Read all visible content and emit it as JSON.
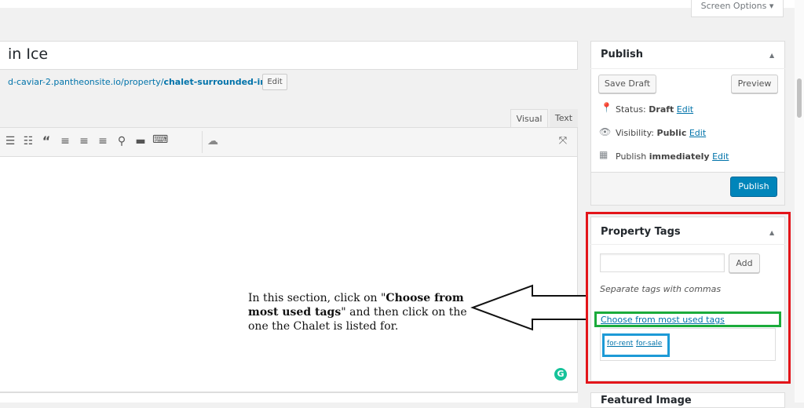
{
  "header": {
    "screen_options_label": "Screen Options ▾"
  },
  "post": {
    "title": "in Ice",
    "permalink_prefix": "d-caviar-2.pantheonsite.io/property/",
    "permalink_slug": "chalet-surrounded-in-ice",
    "permalink_suffix": "/",
    "permalink_edit_label": "Edit"
  },
  "editor": {
    "tabs": {
      "visual": "Visual",
      "text": "Text"
    },
    "toolbar_icons": [
      "bullet-list-icon",
      "numbered-list-icon",
      "blockquote-icon",
      "align-left-icon",
      "align-center-icon",
      "align-right-icon",
      "link-icon",
      "read-more-icon",
      "toolbar-toggle-icon",
      "cloud-icon",
      "fullscreen-icon"
    ],
    "grammarly_label": "G"
  },
  "annotation": {
    "text_1": "In this section, click on \"",
    "bold": "Choose from most used tags",
    "text_2": "\" and then click on the one the Chalet is listed for."
  },
  "publish": {
    "title": "Publish",
    "save_draft": "Save Draft",
    "preview": "Preview",
    "status_label": "Status:",
    "status_value": "Draft",
    "visibility_label": "Visibility:",
    "visibility_value": "Public",
    "publish_label": "Publish",
    "publish_value": "immediately",
    "edit_label": "Edit",
    "publish_button": "Publish"
  },
  "property_tags": {
    "title": "Property Tags",
    "add_button": "Add",
    "hint": "Separate tags with commas",
    "most_used_link": "Choose from most used tags",
    "tags": [
      "for-rent",
      "for-sale"
    ]
  },
  "featured_image": {
    "title": "Featured Image"
  },
  "colors": {
    "highlight_red": "#e3151a",
    "highlight_green": "#1bab3b",
    "highlight_blue": "#1d9ad6",
    "publish_button": "#0085ba",
    "link": "#0073aa"
  }
}
